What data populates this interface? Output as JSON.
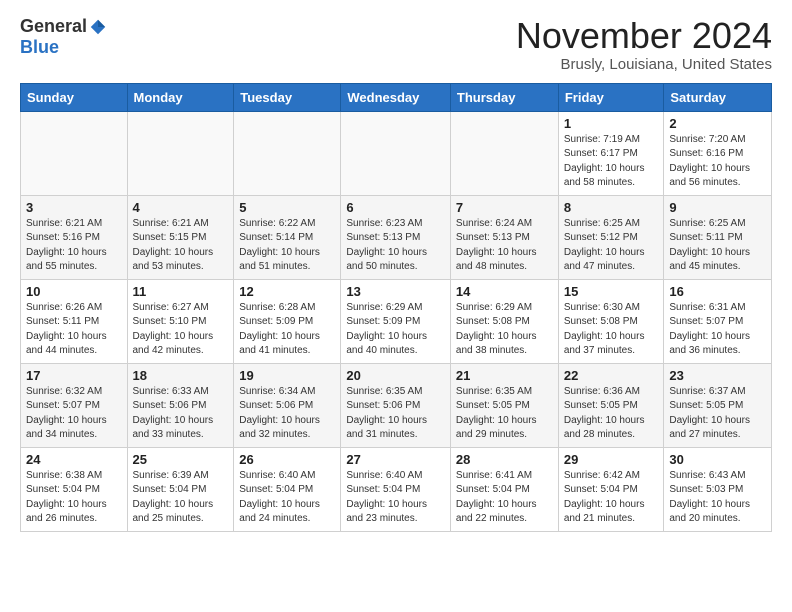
{
  "header": {
    "logo_general": "General",
    "logo_blue": "Blue",
    "month_title": "November 2024",
    "location": "Brusly, Louisiana, United States"
  },
  "days_of_week": [
    "Sunday",
    "Monday",
    "Tuesday",
    "Wednesday",
    "Thursday",
    "Friday",
    "Saturday"
  ],
  "weeks": [
    [
      {
        "day": "",
        "info": ""
      },
      {
        "day": "",
        "info": ""
      },
      {
        "day": "",
        "info": ""
      },
      {
        "day": "",
        "info": ""
      },
      {
        "day": "",
        "info": ""
      },
      {
        "day": "1",
        "info": "Sunrise: 7:19 AM\nSunset: 6:17 PM\nDaylight: 10 hours\nand 58 minutes."
      },
      {
        "day": "2",
        "info": "Sunrise: 7:20 AM\nSunset: 6:16 PM\nDaylight: 10 hours\nand 56 minutes."
      }
    ],
    [
      {
        "day": "3",
        "info": "Sunrise: 6:21 AM\nSunset: 5:16 PM\nDaylight: 10 hours\nand 55 minutes."
      },
      {
        "day": "4",
        "info": "Sunrise: 6:21 AM\nSunset: 5:15 PM\nDaylight: 10 hours\nand 53 minutes."
      },
      {
        "day": "5",
        "info": "Sunrise: 6:22 AM\nSunset: 5:14 PM\nDaylight: 10 hours\nand 51 minutes."
      },
      {
        "day": "6",
        "info": "Sunrise: 6:23 AM\nSunset: 5:13 PM\nDaylight: 10 hours\nand 50 minutes."
      },
      {
        "day": "7",
        "info": "Sunrise: 6:24 AM\nSunset: 5:13 PM\nDaylight: 10 hours\nand 48 minutes."
      },
      {
        "day": "8",
        "info": "Sunrise: 6:25 AM\nSunset: 5:12 PM\nDaylight: 10 hours\nand 47 minutes."
      },
      {
        "day": "9",
        "info": "Sunrise: 6:25 AM\nSunset: 5:11 PM\nDaylight: 10 hours\nand 45 minutes."
      }
    ],
    [
      {
        "day": "10",
        "info": "Sunrise: 6:26 AM\nSunset: 5:11 PM\nDaylight: 10 hours\nand 44 minutes."
      },
      {
        "day": "11",
        "info": "Sunrise: 6:27 AM\nSunset: 5:10 PM\nDaylight: 10 hours\nand 42 minutes."
      },
      {
        "day": "12",
        "info": "Sunrise: 6:28 AM\nSunset: 5:09 PM\nDaylight: 10 hours\nand 41 minutes."
      },
      {
        "day": "13",
        "info": "Sunrise: 6:29 AM\nSunset: 5:09 PM\nDaylight: 10 hours\nand 40 minutes."
      },
      {
        "day": "14",
        "info": "Sunrise: 6:29 AM\nSunset: 5:08 PM\nDaylight: 10 hours\nand 38 minutes."
      },
      {
        "day": "15",
        "info": "Sunrise: 6:30 AM\nSunset: 5:08 PM\nDaylight: 10 hours\nand 37 minutes."
      },
      {
        "day": "16",
        "info": "Sunrise: 6:31 AM\nSunset: 5:07 PM\nDaylight: 10 hours\nand 36 minutes."
      }
    ],
    [
      {
        "day": "17",
        "info": "Sunrise: 6:32 AM\nSunset: 5:07 PM\nDaylight: 10 hours\nand 34 minutes."
      },
      {
        "day": "18",
        "info": "Sunrise: 6:33 AM\nSunset: 5:06 PM\nDaylight: 10 hours\nand 33 minutes."
      },
      {
        "day": "19",
        "info": "Sunrise: 6:34 AM\nSunset: 5:06 PM\nDaylight: 10 hours\nand 32 minutes."
      },
      {
        "day": "20",
        "info": "Sunrise: 6:35 AM\nSunset: 5:06 PM\nDaylight: 10 hours\nand 31 minutes."
      },
      {
        "day": "21",
        "info": "Sunrise: 6:35 AM\nSunset: 5:05 PM\nDaylight: 10 hours\nand 29 minutes."
      },
      {
        "day": "22",
        "info": "Sunrise: 6:36 AM\nSunset: 5:05 PM\nDaylight: 10 hours\nand 28 minutes."
      },
      {
        "day": "23",
        "info": "Sunrise: 6:37 AM\nSunset: 5:05 PM\nDaylight: 10 hours\nand 27 minutes."
      }
    ],
    [
      {
        "day": "24",
        "info": "Sunrise: 6:38 AM\nSunset: 5:04 PM\nDaylight: 10 hours\nand 26 minutes."
      },
      {
        "day": "25",
        "info": "Sunrise: 6:39 AM\nSunset: 5:04 PM\nDaylight: 10 hours\nand 25 minutes."
      },
      {
        "day": "26",
        "info": "Sunrise: 6:40 AM\nSunset: 5:04 PM\nDaylight: 10 hours\nand 24 minutes."
      },
      {
        "day": "27",
        "info": "Sunrise: 6:40 AM\nSunset: 5:04 PM\nDaylight: 10 hours\nand 23 minutes."
      },
      {
        "day": "28",
        "info": "Sunrise: 6:41 AM\nSunset: 5:04 PM\nDaylight: 10 hours\nand 22 minutes."
      },
      {
        "day": "29",
        "info": "Sunrise: 6:42 AM\nSunset: 5:04 PM\nDaylight: 10 hours\nand 21 minutes."
      },
      {
        "day": "30",
        "info": "Sunrise: 6:43 AM\nSunset: 5:03 PM\nDaylight: 10 hours\nand 20 minutes."
      }
    ]
  ]
}
